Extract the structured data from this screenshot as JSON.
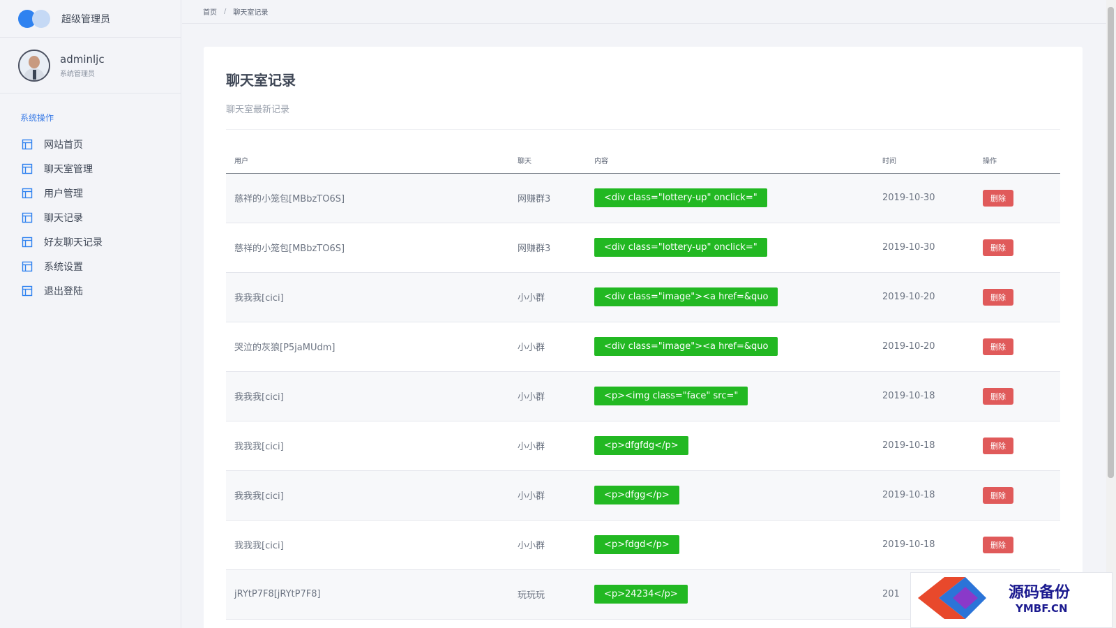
{
  "brand": {
    "title": "超级管理员"
  },
  "user": {
    "name": "adminljc",
    "role": "系统管理员"
  },
  "nav": {
    "section": "系统操作",
    "items": [
      {
        "label": "网站首页"
      },
      {
        "label": "聊天室管理"
      },
      {
        "label": "用户管理"
      },
      {
        "label": "聊天记录"
      },
      {
        "label": "好友聊天记录"
      },
      {
        "label": "系统设置"
      },
      {
        "label": "退出登陆"
      }
    ]
  },
  "breadcrumb": {
    "home": "首页",
    "separator": "/",
    "current": "聊天室记录"
  },
  "card": {
    "title": "聊天室记录",
    "subtitle": "聊天室最新记录"
  },
  "table": {
    "headers": {
      "user": "用户",
      "chat": "聊天",
      "content": "内容",
      "time": "时间",
      "action": "操作"
    },
    "rows": [
      {
        "user": "慈祥的小笼包[MBbzTO6S]",
        "chat": "网赚群3",
        "content": "<div class=\"lottery-up\" onclick=\"",
        "time": "2019-10-30",
        "action": "删除"
      },
      {
        "user": "慈祥的小笼包[MBbzTO6S]",
        "chat": "网赚群3",
        "content": "<div class=\"lottery-up\" onclick=\"",
        "time": "2019-10-30",
        "action": "删除"
      },
      {
        "user": "我我我[cici]",
        "chat": "小小群",
        "content": "<div class=\"image\"><a href=&quo",
        "time": "2019-10-20",
        "action": "删除"
      },
      {
        "user": "哭泣的灰狼[P5jaMUdm]",
        "chat": "小小群",
        "content": "<div class=\"image\"><a href=&quo",
        "time": "2019-10-20",
        "action": "删除"
      },
      {
        "user": "我我我[cici]",
        "chat": "小小群",
        "content": "<p><img class=\"face\" src=\"",
        "time": "2019-10-18",
        "action": "删除"
      },
      {
        "user": "我我我[cici]",
        "chat": "小小群",
        "content": "<p>dfgfdg</p>",
        "time": "2019-10-18",
        "action": "删除"
      },
      {
        "user": "我我我[cici]",
        "chat": "小小群",
        "content": "<p>dfgg</p>",
        "time": "2019-10-18",
        "action": "删除"
      },
      {
        "user": "我我我[cici]",
        "chat": "小小群",
        "content": "<p>fdgd</p>",
        "time": "2019-10-18",
        "action": "删除"
      },
      {
        "user": "jRYtP7F8[jRYtP7F8]",
        "chat": "玩玩玩",
        "content": "<p>24234</p>",
        "time": "201",
        "action": ""
      }
    ]
  },
  "watermark": {
    "text": "源码备份",
    "domain": "YMBF.CN"
  },
  "colors": {
    "accent": "#2f82f0",
    "badge_green": "#22b822",
    "delete_red": "#e05a5a"
  },
  "icons": {
    "nav_item": "layout-icon"
  }
}
